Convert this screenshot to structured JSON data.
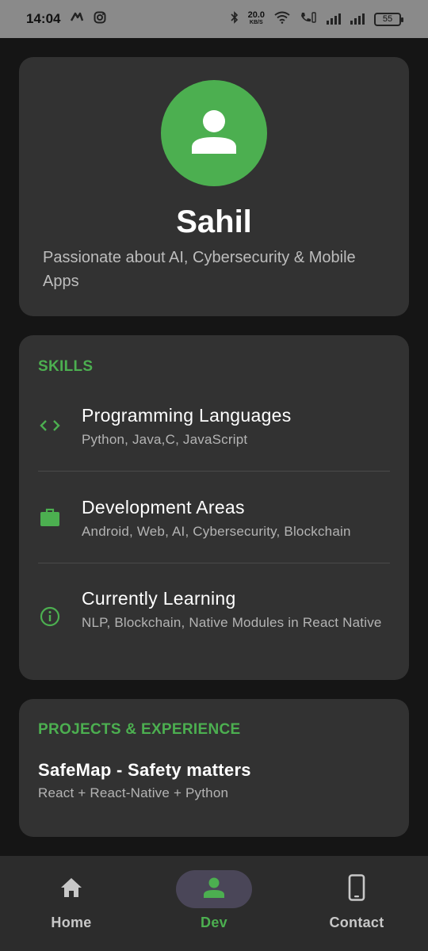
{
  "status_bar": {
    "time": "14:04",
    "net_speed": "20.0",
    "net_unit": "KB/S",
    "battery": "55"
  },
  "profile": {
    "name": "Sahil",
    "bio": "Passionate about AI, Cybersecurity & Mobile Apps",
    "avatar_icon": "person-icon",
    "accent_color": "#4caf50"
  },
  "skills": {
    "title": "SKILLS",
    "items": [
      {
        "icon": "code-icon",
        "title": "Programming Languages",
        "desc": "Python, Java,C, JavaScript"
      },
      {
        "icon": "briefcase-icon",
        "title": "Development Areas",
        "desc": "Android, Web, AI, Cybersecurity, Blockchain"
      },
      {
        "icon": "info-icon",
        "title": "Currently Learning",
        "desc": "NLP, Blockchain, Native Modules in React Native"
      }
    ]
  },
  "projects": {
    "title": "PROJECTS & EXPERIENCE",
    "items": [
      {
        "title": "SafeMap - Safety matters",
        "stack": "React + React-Native + Python"
      }
    ]
  },
  "nav": {
    "items": [
      {
        "icon": "home-icon",
        "label": "Home",
        "active": false
      },
      {
        "icon": "person-icon",
        "label": "Dev",
        "active": true
      },
      {
        "icon": "phone-icon",
        "label": "Contact",
        "active": false
      }
    ]
  }
}
